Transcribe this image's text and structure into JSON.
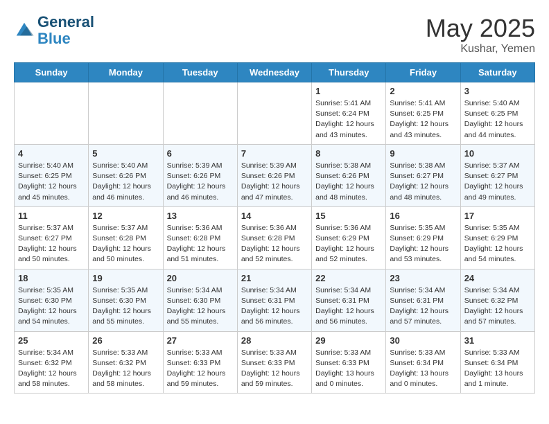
{
  "header": {
    "logo_line1": "General",
    "logo_line2": "Blue",
    "month": "May 2025",
    "location": "Kushar, Yemen"
  },
  "days_of_week": [
    "Sunday",
    "Monday",
    "Tuesday",
    "Wednesday",
    "Thursday",
    "Friday",
    "Saturday"
  ],
  "weeks": [
    [
      {
        "day": "",
        "text": ""
      },
      {
        "day": "",
        "text": ""
      },
      {
        "day": "",
        "text": ""
      },
      {
        "day": "",
        "text": ""
      },
      {
        "day": "1",
        "text": "Sunrise: 5:41 AM\nSunset: 6:24 PM\nDaylight: 12 hours\nand 43 minutes."
      },
      {
        "day": "2",
        "text": "Sunrise: 5:41 AM\nSunset: 6:25 PM\nDaylight: 12 hours\nand 43 minutes."
      },
      {
        "day": "3",
        "text": "Sunrise: 5:40 AM\nSunset: 6:25 PM\nDaylight: 12 hours\nand 44 minutes."
      }
    ],
    [
      {
        "day": "4",
        "text": "Sunrise: 5:40 AM\nSunset: 6:25 PM\nDaylight: 12 hours\nand 45 minutes."
      },
      {
        "day": "5",
        "text": "Sunrise: 5:40 AM\nSunset: 6:26 PM\nDaylight: 12 hours\nand 46 minutes."
      },
      {
        "day": "6",
        "text": "Sunrise: 5:39 AM\nSunset: 6:26 PM\nDaylight: 12 hours\nand 46 minutes."
      },
      {
        "day": "7",
        "text": "Sunrise: 5:39 AM\nSunset: 6:26 PM\nDaylight: 12 hours\nand 47 minutes."
      },
      {
        "day": "8",
        "text": "Sunrise: 5:38 AM\nSunset: 6:26 PM\nDaylight: 12 hours\nand 48 minutes."
      },
      {
        "day": "9",
        "text": "Sunrise: 5:38 AM\nSunset: 6:27 PM\nDaylight: 12 hours\nand 48 minutes."
      },
      {
        "day": "10",
        "text": "Sunrise: 5:37 AM\nSunset: 6:27 PM\nDaylight: 12 hours\nand 49 minutes."
      }
    ],
    [
      {
        "day": "11",
        "text": "Sunrise: 5:37 AM\nSunset: 6:27 PM\nDaylight: 12 hours\nand 50 minutes."
      },
      {
        "day": "12",
        "text": "Sunrise: 5:37 AM\nSunset: 6:28 PM\nDaylight: 12 hours\nand 50 minutes."
      },
      {
        "day": "13",
        "text": "Sunrise: 5:36 AM\nSunset: 6:28 PM\nDaylight: 12 hours\nand 51 minutes."
      },
      {
        "day": "14",
        "text": "Sunrise: 5:36 AM\nSunset: 6:28 PM\nDaylight: 12 hours\nand 52 minutes."
      },
      {
        "day": "15",
        "text": "Sunrise: 5:36 AM\nSunset: 6:29 PM\nDaylight: 12 hours\nand 52 minutes."
      },
      {
        "day": "16",
        "text": "Sunrise: 5:35 AM\nSunset: 6:29 PM\nDaylight: 12 hours\nand 53 minutes."
      },
      {
        "day": "17",
        "text": "Sunrise: 5:35 AM\nSunset: 6:29 PM\nDaylight: 12 hours\nand 54 minutes."
      }
    ],
    [
      {
        "day": "18",
        "text": "Sunrise: 5:35 AM\nSunset: 6:30 PM\nDaylight: 12 hours\nand 54 minutes."
      },
      {
        "day": "19",
        "text": "Sunrise: 5:35 AM\nSunset: 6:30 PM\nDaylight: 12 hours\nand 55 minutes."
      },
      {
        "day": "20",
        "text": "Sunrise: 5:34 AM\nSunset: 6:30 PM\nDaylight: 12 hours\nand 55 minutes."
      },
      {
        "day": "21",
        "text": "Sunrise: 5:34 AM\nSunset: 6:31 PM\nDaylight: 12 hours\nand 56 minutes."
      },
      {
        "day": "22",
        "text": "Sunrise: 5:34 AM\nSunset: 6:31 PM\nDaylight: 12 hours\nand 56 minutes."
      },
      {
        "day": "23",
        "text": "Sunrise: 5:34 AM\nSunset: 6:31 PM\nDaylight: 12 hours\nand 57 minutes."
      },
      {
        "day": "24",
        "text": "Sunrise: 5:34 AM\nSunset: 6:32 PM\nDaylight: 12 hours\nand 57 minutes."
      }
    ],
    [
      {
        "day": "25",
        "text": "Sunrise: 5:34 AM\nSunset: 6:32 PM\nDaylight: 12 hours\nand 58 minutes."
      },
      {
        "day": "26",
        "text": "Sunrise: 5:33 AM\nSunset: 6:32 PM\nDaylight: 12 hours\nand 58 minutes."
      },
      {
        "day": "27",
        "text": "Sunrise: 5:33 AM\nSunset: 6:33 PM\nDaylight: 12 hours\nand 59 minutes."
      },
      {
        "day": "28",
        "text": "Sunrise: 5:33 AM\nSunset: 6:33 PM\nDaylight: 12 hours\nand 59 minutes."
      },
      {
        "day": "29",
        "text": "Sunrise: 5:33 AM\nSunset: 6:33 PM\nDaylight: 13 hours\nand 0 minutes."
      },
      {
        "day": "30",
        "text": "Sunrise: 5:33 AM\nSunset: 6:34 PM\nDaylight: 13 hours\nand 0 minutes."
      },
      {
        "day": "31",
        "text": "Sunrise: 5:33 AM\nSunset: 6:34 PM\nDaylight: 13 hours\nand 1 minute."
      }
    ]
  ]
}
